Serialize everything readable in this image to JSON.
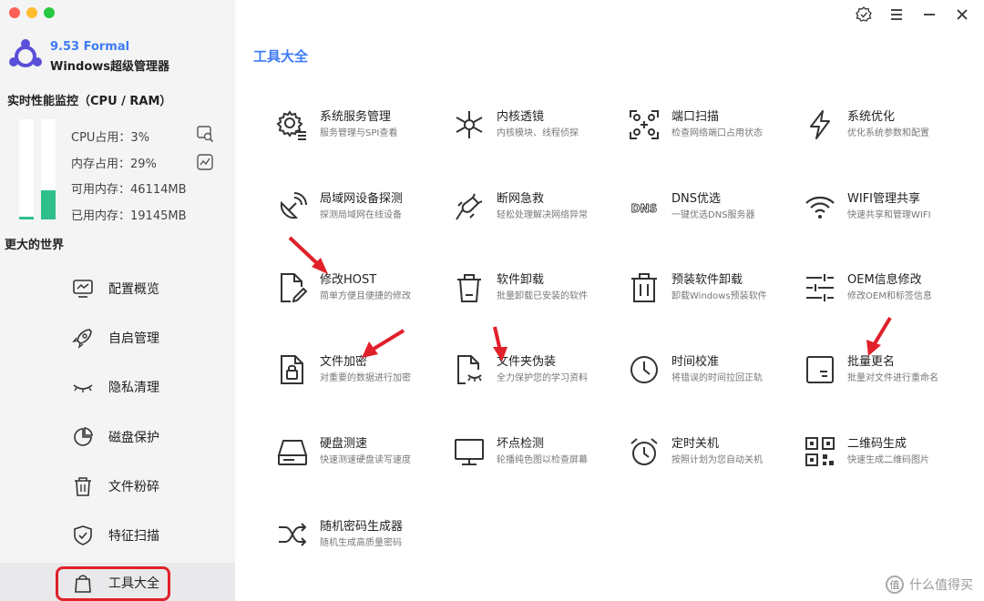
{
  "app": {
    "version": "9.53 Formal",
    "name": "Windows超级管理器"
  },
  "colors": {
    "accent": "#3d7bf5",
    "bar_fill": "#2fbf8a",
    "highlight": "#e0202a"
  },
  "monitor": {
    "title": "实时性能监控（CPU / RAM）",
    "cpu_label": "CPU占用：3%",
    "mem_label": "内存占用：29%",
    "avail_label": "可用内存：46114MB",
    "used_label": "已用内存：19145MB",
    "cpu_fraction": 0.03,
    "mem_fraction": 0.29
  },
  "slogan": "更大的世界",
  "nav": [
    {
      "label": "配置概览",
      "icon": "monitor-chart-icon"
    },
    {
      "label": "自启管理",
      "icon": "rocket-icon"
    },
    {
      "label": "隐私清理",
      "icon": "closed-eye-icon"
    },
    {
      "label": "磁盘保护",
      "icon": "pie-icon"
    },
    {
      "label": "文件粉碎",
      "icon": "trash-icon"
    },
    {
      "label": "特征扫描",
      "icon": "shield-check-icon"
    },
    {
      "label": "工具大全",
      "icon": "bag-icon",
      "active": true
    }
  ],
  "page_title": "工具大全",
  "tools": [
    {
      "name": "系统服务管理",
      "desc": "服务管理与SPI查看",
      "icon": "gear-list-icon"
    },
    {
      "name": "内核透镜",
      "desc": "内核模块、线程侦探",
      "icon": "atom-icon"
    },
    {
      "name": "端口扫描",
      "desc": "检查网络端口占用状态",
      "icon": "port-scan-icon"
    },
    {
      "name": "系统优化",
      "desc": "优化系统参数和配置",
      "icon": "lightning-icon"
    },
    {
      "name": "局域网设备探测",
      "desc": "探测局域网在线设备",
      "icon": "satellite-icon"
    },
    {
      "name": "断网急救",
      "desc": "轻松处理解决网络异常",
      "icon": "plug-icon"
    },
    {
      "name": "DNS优选",
      "desc": "一键优选DNS服务器",
      "icon": "dns-icon",
      "glyph": "DNS"
    },
    {
      "name": "WIFI管理共享",
      "desc": "快速共享和管理WIFI",
      "icon": "wifi-icon"
    },
    {
      "name": "修改HOST",
      "desc": "简单方便且便捷的修改",
      "icon": "file-edit-icon"
    },
    {
      "name": "软件卸载",
      "desc": "批量卸载已安装的软件",
      "icon": "bin-icon"
    },
    {
      "name": "预装软件卸载",
      "desc": "卸载Windows预装软件",
      "icon": "bin-lines-icon"
    },
    {
      "name": "OEM信息修改",
      "desc": "修改OEM和标签信息",
      "icon": "sliders-icon"
    },
    {
      "name": "文件加密",
      "desc": "对重要的数据进行加密",
      "icon": "file-lock-icon"
    },
    {
      "name": "文件夹伪装",
      "desc": "全力保护您的学习资料",
      "icon": "file-mask-icon"
    },
    {
      "name": "时间校准",
      "desc": "将错误的时间拉回正轨",
      "icon": "clock-icon"
    },
    {
      "name": "批量更名",
      "desc": "批量对文件进行重命名",
      "icon": "rename-icon"
    },
    {
      "name": "硬盘测速",
      "desc": "快速测速硬盘读写速度",
      "icon": "hdd-icon"
    },
    {
      "name": "坏点检测",
      "desc": "轮播纯色图以检查屏幕",
      "icon": "screen-icon"
    },
    {
      "name": "定时关机",
      "desc": "按照计划为您自动关机",
      "icon": "alarm-icon"
    },
    {
      "name": "二维码生成",
      "desc": "快速生成二维码图片",
      "icon": "qrcode-icon"
    },
    {
      "name": "随机密码生成器",
      "desc": "随机生成高质量密码",
      "icon": "shuffle-icon"
    }
  ],
  "watermark": {
    "glyph": "值",
    "text": "什么值得买"
  }
}
